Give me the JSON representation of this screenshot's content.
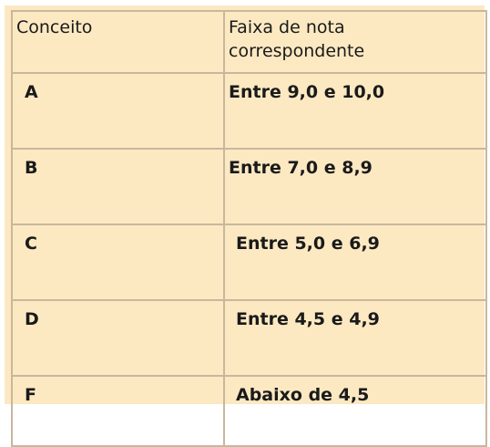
{
  "table": {
    "header": {
      "col1": "Conceito",
      "col2_line1": "Faixa de nota",
      "col2_line2": "correspondente"
    },
    "rows": [
      {
        "grade": "A",
        "range": "Entre 9,0 e 10,0"
      },
      {
        "grade": "B",
        "range": "Entre 7,0 e 8,9"
      },
      {
        "grade": "C",
        "range": "Entre 5,0 e 6,9"
      },
      {
        "grade": "D",
        "range": "Entre 4,5 e 4,9"
      },
      {
        "grade": "F",
        "range": "Abaixo de 4,5"
      }
    ]
  },
  "colors": {
    "background": "#fce9c2",
    "border": "#c7b79d",
    "text": "#1a1a1a"
  }
}
